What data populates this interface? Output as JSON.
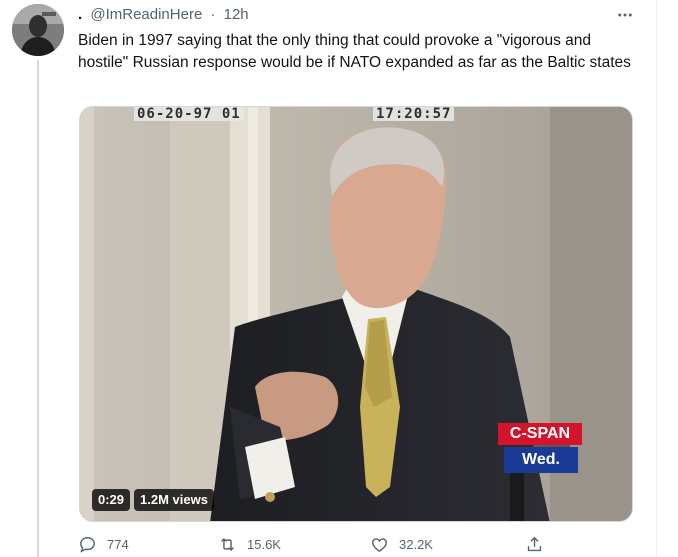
{
  "tweet": {
    "display_name": ".",
    "handle": "@ImReadinHere",
    "separator": "·",
    "time": "12h",
    "text": "Biden in 1997 saying that the only thing that could provoke a \"vigorous and hostile\" Russian response would be if NATO expanded as far as the Baltic states",
    "more_icon": "more-horizontal-icon"
  },
  "video": {
    "timestamp_date": "06-20-97 01",
    "timestamp_time": "17:20:57",
    "network": "C-SPAN",
    "day": "Wed.",
    "duration": "0:29",
    "views": "1.2M views"
  },
  "actions": {
    "replies": "774",
    "retweets": "15.6K",
    "likes": "32.2K",
    "icons": [
      "reply-icon",
      "retweet-icon",
      "like-icon",
      "share-icon"
    ]
  },
  "colors": {
    "text": "#0f1419",
    "secondary": "#536471",
    "cspan_red": "#d3142b",
    "cspan_blue": "#1b3a95"
  }
}
